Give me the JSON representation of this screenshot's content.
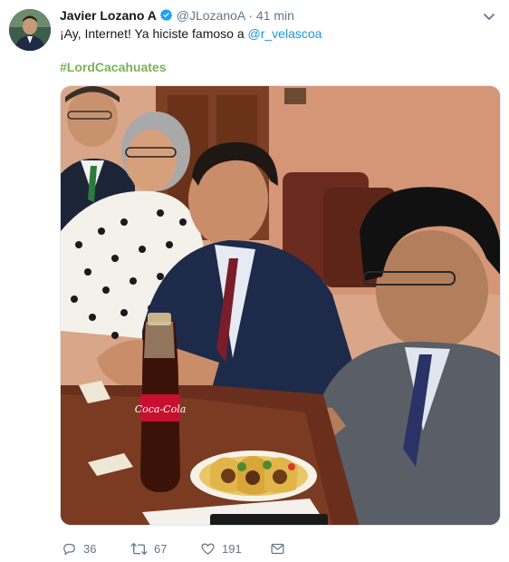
{
  "tweet": {
    "author_name": "Javier Lozano A",
    "handle": "@JLozanoA",
    "separator": "·",
    "time": "41 min",
    "text_before": "¡Ay, Internet! Ya hiciste famoso a ",
    "mention": "@r_velascoa",
    "hashtag": "#LordCacahuates"
  },
  "media": {
    "bottle_label": "Coca-Cola"
  },
  "actions": {
    "reply_count": "36",
    "retweet_count": "67",
    "like_count": "191"
  },
  "colors": {
    "link": "#1b95e0",
    "hashtag": "#77b255",
    "muted": "#657786",
    "verified": "#1da1f2"
  },
  "icons": [
    "avatar",
    "verified-badge-icon",
    "chevron-down-icon",
    "reply-icon",
    "retweet-icon",
    "like-icon",
    "direct-message-icon"
  ]
}
